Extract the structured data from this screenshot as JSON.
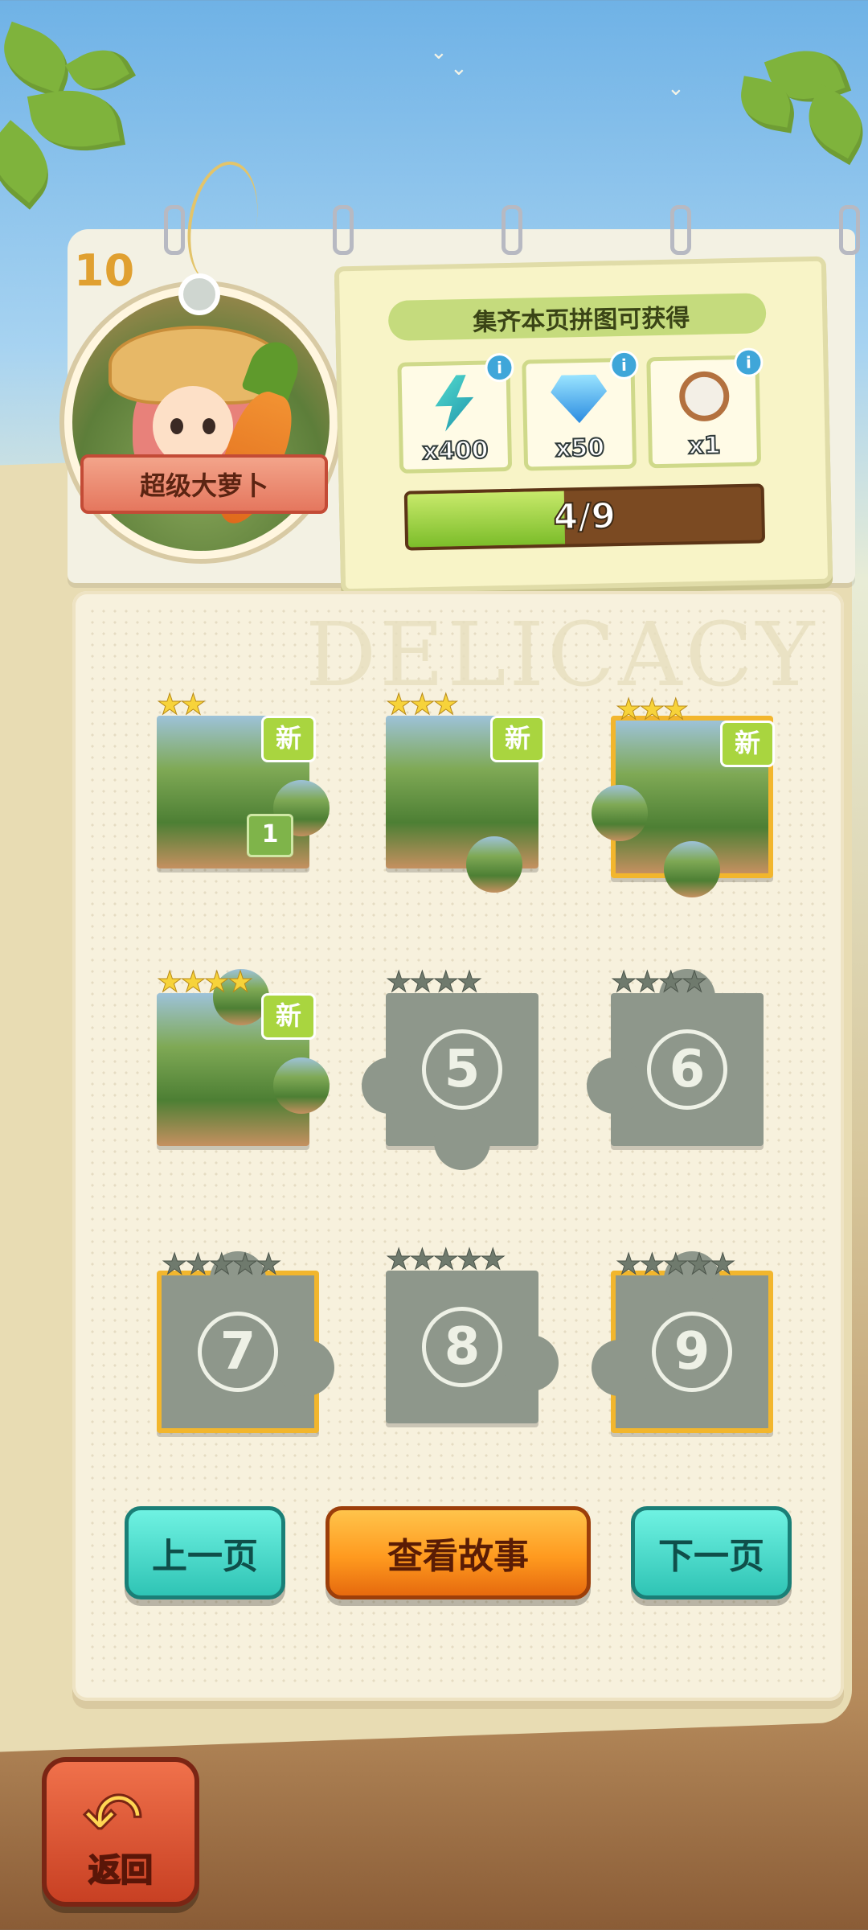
{
  "chapter": {
    "number": "10",
    "name": "超级大萝卜"
  },
  "rewards": {
    "title": "集齐本页拼图可获得",
    "items": [
      {
        "icon": "lightning-icon",
        "qty": "x400"
      },
      {
        "icon": "diamond-icon",
        "qty": "x50"
      },
      {
        "icon": "stopwatch-icon",
        "qty": "x1"
      }
    ],
    "progress_text": "4/9",
    "progress_value": 0.444
  },
  "watermark": "DELICACY",
  "pieces": [
    {
      "label": "",
      "stars_on": 2,
      "stars_total": 2,
      "new": "新",
      "count": "1"
    },
    {
      "label": "",
      "stars_on": 3,
      "stars_total": 3,
      "new": "新",
      "count": ""
    },
    {
      "label": "",
      "stars_on": 3,
      "stars_total": 3,
      "new": "新",
      "count": ""
    },
    {
      "label": "",
      "stars_on": 4,
      "stars_total": 4,
      "new": "新",
      "count": ""
    },
    {
      "label": "5",
      "stars_on": 0,
      "stars_total": 4,
      "new": "",
      "count": ""
    },
    {
      "label": "6",
      "stars_on": 0,
      "stars_total": 4,
      "new": "",
      "count": ""
    },
    {
      "label": "7",
      "stars_on": 0,
      "stars_total": 5,
      "new": "",
      "count": ""
    },
    {
      "label": "8",
      "stars_on": 0,
      "stars_total": 5,
      "new": "",
      "count": ""
    },
    {
      "label": "9",
      "stars_on": 0,
      "stars_total": 5,
      "new": "",
      "count": ""
    }
  ],
  "buttons": {
    "prev": "上一页",
    "story": "查看故事",
    "next": "下一页",
    "back": "返回"
  },
  "colors": {
    "accent_teal": "#2fc4b5",
    "accent_orange": "#ff9a1f",
    "new_badge": "#a9d53f",
    "star": "#f7d33a"
  }
}
